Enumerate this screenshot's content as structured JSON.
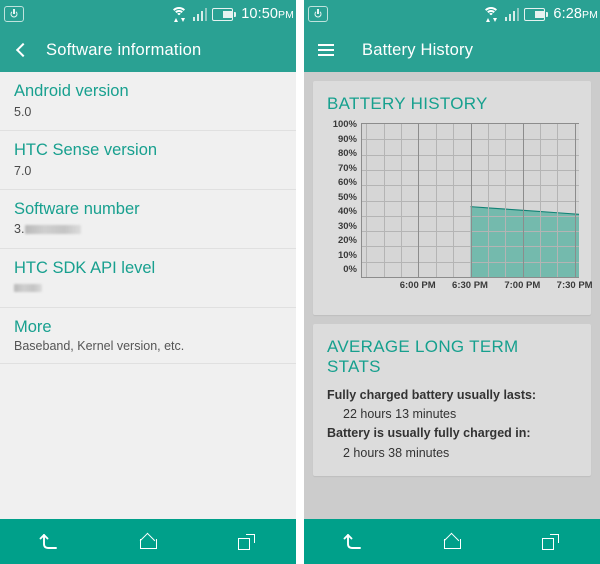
{
  "left": {
    "status": {
      "power_icon": "power-standby-icon",
      "wifi_icon": "wifi-icon",
      "signal_icon": "cellular-signal-icon",
      "battery_icon": "battery-icon",
      "time": "10:50",
      "ampm": "PM"
    },
    "appbar": {
      "back_icon": "back-chevron-icon",
      "title": "Software information"
    },
    "rows": [
      {
        "title": "Android version",
        "value": "5.0",
        "redacted": false
      },
      {
        "title": "HTC Sense version",
        "value": "7.0",
        "redacted": false
      },
      {
        "title": "Software number",
        "value": "3.",
        "redacted": "wide"
      },
      {
        "title": "HTC SDK API level",
        "value": "",
        "redacted": "narrow"
      },
      {
        "title": "More",
        "value": "",
        "sub": "Baseband, Kernel version, etc.",
        "redacted": false
      }
    ]
  },
  "right": {
    "status": {
      "power_icon": "power-standby-icon",
      "wifi_icon": "wifi-icon",
      "signal_icon": "cellular-signal-icon",
      "battery_icon": "battery-icon",
      "time": "6:28",
      "ampm": "PM"
    },
    "appbar": {
      "menu_icon": "hamburger-menu-icon",
      "title": "Battery History"
    },
    "chart_card_title": "BATTERY HISTORY",
    "stats_card_title": "AVERAGE LONG TERM STATS",
    "stats": [
      {
        "label": "Fully charged battery usually lasts:",
        "value": "22 hours 13 minutes"
      },
      {
        "label": "Battery is usually fully charged in:",
        "value": "2 hours 38 minutes"
      }
    ]
  },
  "navbar": {
    "back_icon": "back-arrow-icon",
    "home_icon": "home-icon",
    "recents_icon": "recent-apps-icon"
  },
  "colors": {
    "teal_header": "#2aa193",
    "teal_nav": "#00a08a",
    "teal_accent": "#18a08f",
    "area_fill": "#6fb8ab",
    "area_stroke": "#128275",
    "list_bg": "#f0f0f0",
    "panel_bg": "#cccccc",
    "card_bg": "#dcdcdc"
  },
  "chart_data": {
    "type": "area",
    "title": "BATTERY HISTORY",
    "xlabel": "",
    "ylabel": "",
    "ylim": [
      0,
      100
    ],
    "ytick_labels": [
      "100%",
      "90%",
      "80%",
      "70%",
      "60%",
      "50%",
      "40%",
      "30%",
      "20%",
      "10%",
      "0%"
    ],
    "ytick_values": [
      100,
      90,
      80,
      70,
      60,
      50,
      40,
      30,
      20,
      10,
      0
    ],
    "xtick_labels": [
      "6:00 PM",
      "6:30 PM",
      "7:00 PM",
      "7:30 PM"
    ],
    "xtick_positions": [
      0.26,
      0.5,
      0.74,
      0.98
    ],
    "grid": true,
    "legend": "none",
    "series": [
      {
        "name": "Battery level",
        "x": [
          "6:30 PM",
          "6:45 PM",
          "7:00 PM",
          "7:15 PM",
          "7:30 PM",
          "7:45 PM"
        ],
        "values": [
          46,
          45,
          44,
          43,
          42,
          41
        ]
      }
    ],
    "notes": "Area chart; data begins abruptly at 6:30 PM rising from 0% to 46%, then declines linearly to about 41% at the right plot edge (~7:45 PM). Region left of 6:30 PM has no data."
  }
}
